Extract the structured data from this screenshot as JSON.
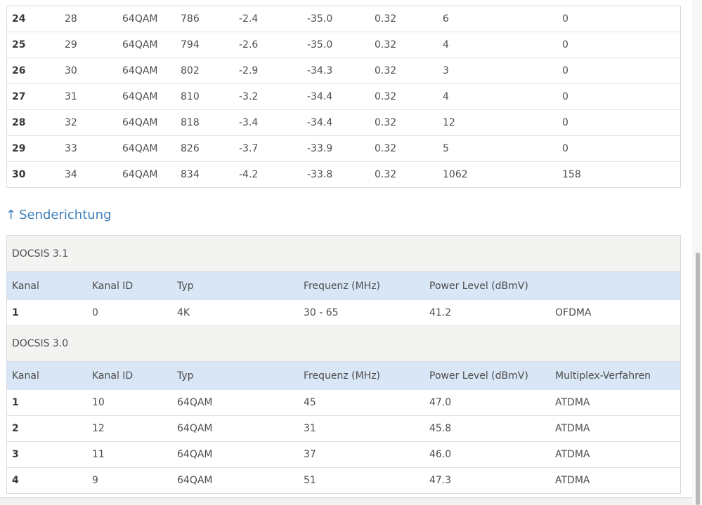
{
  "downstream": {
    "rows": [
      {
        "kanal": "24",
        "kanal_id": "28",
        "typ": "64QAM",
        "freq": "786",
        "power": "-2.4",
        "snr": "-35.0",
        "extra": "0.32",
        "corr": "6",
        "uncorr": "0"
      },
      {
        "kanal": "25",
        "kanal_id": "29",
        "typ": "64QAM",
        "freq": "794",
        "power": "-2.6",
        "snr": "-35.0",
        "extra": "0.32",
        "corr": "4",
        "uncorr": "0"
      },
      {
        "kanal": "26",
        "kanal_id": "30",
        "typ": "64QAM",
        "freq": "802",
        "power": "-2.9",
        "snr": "-34.3",
        "extra": "0.32",
        "corr": "3",
        "uncorr": "0"
      },
      {
        "kanal": "27",
        "kanal_id": "31",
        "typ": "64QAM",
        "freq": "810",
        "power": "-3.2",
        "snr": "-34.4",
        "extra": "0.32",
        "corr": "4",
        "uncorr": "0"
      },
      {
        "kanal": "28",
        "kanal_id": "32",
        "typ": "64QAM",
        "freq": "818",
        "power": "-3.4",
        "snr": "-34.4",
        "extra": "0.32",
        "corr": "12",
        "uncorr": "0"
      },
      {
        "kanal": "29",
        "kanal_id": "33",
        "typ": "64QAM",
        "freq": "826",
        "power": "-3.7",
        "snr": "-33.9",
        "extra": "0.32",
        "corr": "5",
        "uncorr": "0"
      },
      {
        "kanal": "30",
        "kanal_id": "34",
        "typ": "64QAM",
        "freq": "834",
        "power": "-4.2",
        "snr": "-33.8",
        "extra": "0.32",
        "corr": "1062",
        "uncorr": "158"
      }
    ]
  },
  "upstream": {
    "section_arrow": "↑",
    "section_title": "Senderichtung",
    "docsis31": {
      "label": "DOCSIS 3.1",
      "headers": [
        "Kanal",
        "Kanal ID",
        "Typ",
        "Frequenz (MHz)",
        "Power Level (dBmV)",
        ""
      ],
      "rows": [
        {
          "kanal": "1",
          "kanal_id": "0",
          "typ": "4K",
          "freq": "30 - 65",
          "power": "41.2",
          "mux": "OFDMA"
        }
      ]
    },
    "docsis30": {
      "label": "DOCSIS 3.0",
      "headers": [
        "Kanal",
        "Kanal ID",
        "Typ",
        "Frequenz (MHz)",
        "Power Level (dBmV)",
        "Multiplex-Verfahren"
      ],
      "rows": [
        {
          "kanal": "1",
          "kanal_id": "10",
          "typ": "64QAM",
          "freq": "45",
          "power": "47.0",
          "mux": "ATDMA"
        },
        {
          "kanal": "2",
          "kanal_id": "12",
          "typ": "64QAM",
          "freq": "31",
          "power": "45.8",
          "mux": "ATDMA"
        },
        {
          "kanal": "3",
          "kanal_id": "11",
          "typ": "64QAM",
          "freq": "37",
          "power": "46.0",
          "mux": "ATDMA"
        },
        {
          "kanal": "4",
          "kanal_id": "9",
          "typ": "64QAM",
          "freq": "51",
          "power": "47.3",
          "mux": "ATDMA"
        }
      ]
    }
  }
}
